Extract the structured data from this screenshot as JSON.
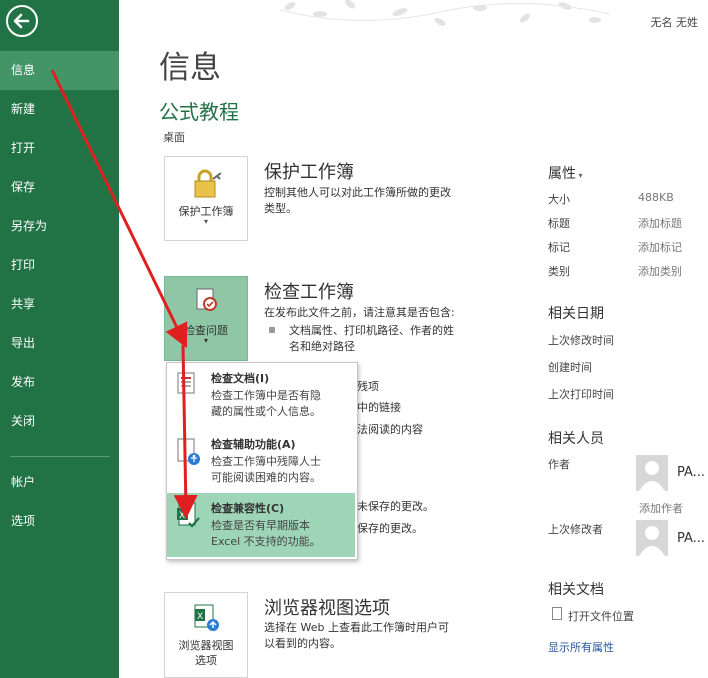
{
  "user": {
    "name": "无名 无姓"
  },
  "sidebar": {
    "items": [
      {
        "label": "信息",
        "active": true
      },
      {
        "label": "新建"
      },
      {
        "label": "打开"
      },
      {
        "label": "保存"
      },
      {
        "label": "另存为"
      },
      {
        "label": "打印"
      },
      {
        "label": "共享"
      },
      {
        "label": "导出"
      },
      {
        "label": "发布"
      },
      {
        "label": "关闭"
      },
      {
        "label": "帐户"
      },
      {
        "label": "选项"
      }
    ]
  },
  "main": {
    "title": "信息",
    "workbook_name": "公式教程",
    "location": "桌面",
    "protect": {
      "button_label": "保护工作簿",
      "title": "保护工作簿",
      "desc_line1": "控制其他人可以对此工作簿所做的更改",
      "desc_line2": "类型。"
    },
    "inspect": {
      "button_label": "检查问题",
      "title": "检查工作簿",
      "desc": "在发布此文件之前，请注意其是否包含:",
      "bullet_line1": "文档属性、打印机路径、作者的姓",
      "bullet_line2": "名和绝对路径",
      "partial1": "残项",
      "partial2": "中的链接",
      "partial3": "法阅读的内容"
    },
    "manage": {
      "partial1": "未保存的更改。",
      "partial2": "保存的更改。"
    },
    "browser": {
      "button_line1": "浏览器视图",
      "button_line2": "选项",
      "title": "浏览器视图选项",
      "desc_line1": "选择在 Web 上查看此工作簿时用户可",
      "desc_line2": "以看到的内容。"
    }
  },
  "dropdown": {
    "items": [
      {
        "title": "检查文档(I)",
        "desc_line1": "检查工作簿中是否有隐",
        "desc_line2": "藏的属性或个人信息。"
      },
      {
        "title": "检查辅助功能(A)",
        "desc_line1": "检查工作簿中残障人士",
        "desc_line2": "可能阅读困难的内容。"
      },
      {
        "title": "检查兼容性(C)",
        "desc_line1": "检查是否有早期版本",
        "desc_line2": "Excel 不支持的功能。",
        "highlighted": true
      }
    ]
  },
  "properties": {
    "header": "属性",
    "rows": [
      {
        "label": "大小",
        "value": "488KB"
      },
      {
        "label": "标题",
        "value": "添加标题"
      },
      {
        "label": "标记",
        "value": "添加标记"
      },
      {
        "label": "类别",
        "value": "添加类别"
      }
    ],
    "dates_header": "相关日期",
    "dates": [
      {
        "label": "上次修改时间"
      },
      {
        "label": "创建时间"
      },
      {
        "label": "上次打印时间"
      }
    ],
    "people_header": "相关人员",
    "author_label": "作者",
    "author_name": "PA...",
    "add_author": "添加作者",
    "modifier_label": "上次修改者",
    "modifier_name": "PA...",
    "docs_header": "相关文档",
    "open_location": "打开文件位置",
    "show_all": "显示所有属性"
  },
  "colors": {
    "accent": "#217346",
    "active_nav": "#439467",
    "highlight": "#9fd5b7",
    "link": "#2b579a",
    "annotation_arrow": "#e02020"
  }
}
